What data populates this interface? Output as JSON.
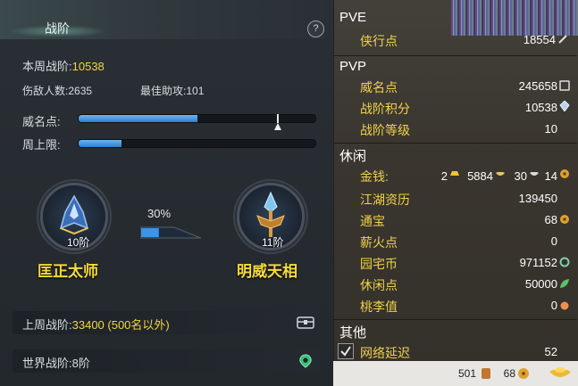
{
  "left_panel": {
    "title": "战阶",
    "help_label": "?",
    "week_rank_label": "本周战阶:",
    "week_rank_value": "10538",
    "kills_label": "伤敌人数:",
    "kills_value": "2635",
    "assists_label": "最佳助攻:",
    "assists_value": "101",
    "fame_label": "威名点:",
    "fame_fill": 0.5,
    "cap_label": "周上限:",
    "cap_fill": 0.18,
    "current_rank": {
      "level": "10阶",
      "name": "匡正太师"
    },
    "next_rank": {
      "level": "11阶",
      "name": "明威天相"
    },
    "progress_percent_label": "30%",
    "progress_fill": 0.3,
    "last_week_label": "上周战阶:",
    "last_week_value": "33400 (500名以外)",
    "world_rank_label": "世界战阶:",
    "world_rank_value": "8阶"
  },
  "right_panel": {
    "pve_title": "PVE",
    "pve_rows": [
      {
        "label": "侠行点",
        "value": "18554"
      }
    ],
    "pvp_title": "PVP",
    "pvp_rows": [
      {
        "label": "威名点",
        "value": "245658"
      },
      {
        "label": "战阶积分",
        "value": "10538"
      },
      {
        "label": "战阶等级",
        "value": "10"
      }
    ],
    "leisure_title": "休闲",
    "money_label": "金钱:",
    "money_gold": "2",
    "money_silver": "5884",
    "money_copper1": "30",
    "money_copper2": "14",
    "leisure_rows": [
      {
        "label": "江湖资历",
        "value": "139450"
      },
      {
        "label": "通宝",
        "value": "68"
      },
      {
        "label": "薪火点",
        "value": "0"
      },
      {
        "label": "园宅币",
        "value": "971152"
      },
      {
        "label": "休闲点",
        "value": "50000"
      },
      {
        "label": "桃李值",
        "value": "0"
      }
    ],
    "other_title": "其他",
    "latency_label": "网络延迟",
    "latency_value": "52",
    "bottom_left_value": "501",
    "bottom_mid_value": "68"
  },
  "colors": {
    "accent_yellow": "#f2d645",
    "bar_blue": "#2d7fd0",
    "panel_bg": "#2a2f35"
  }
}
